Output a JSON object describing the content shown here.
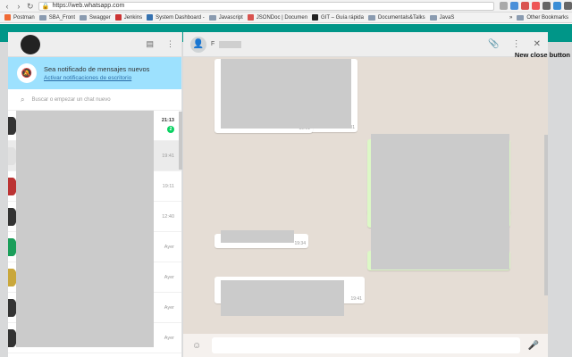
{
  "browser": {
    "url": "https://web.whatsapp.com",
    "bookmarks": [
      "Postman",
      "SBA_Front",
      "Swagger",
      "Jenkins",
      "System Dashboard -",
      "Javascript",
      "JSONDoc | Documen",
      "GIT – Guía rápida",
      "Documentals&Talks",
      "JavaS"
    ],
    "more_label": "»",
    "other_bookmarks": "Other Bookmarks"
  },
  "sidebar": {
    "notification_title": "Sea notificado de mensajes nuevos",
    "notification_link": "Activar notificaciones de escritorio",
    "search_placeholder": "Buscar o empezar un chat nuevo",
    "chats": [
      {
        "time": "21:13",
        "unread": "2"
      },
      {
        "time": "19:41"
      },
      {
        "time": "19:11"
      },
      {
        "time": "12:40"
      },
      {
        "time": "Ayer"
      },
      {
        "time": "Ayer"
      },
      {
        "time": "Ayer"
      },
      {
        "time": "Ayer"
      }
    ]
  },
  "conversation": {
    "contact_initial": "F",
    "annotation": "New close button",
    "messages": [
      {
        "time": "19:01"
      },
      {
        "time": "19:01"
      },
      {
        "time": "19:34"
      },
      {
        "time": "19:41"
      }
    ],
    "compose_placeholder": ""
  },
  "colors": {
    "teal": "#009688",
    "notif": "#9de1fe",
    "outgoing": "#dcf8c6",
    "unread": "#09d261"
  }
}
